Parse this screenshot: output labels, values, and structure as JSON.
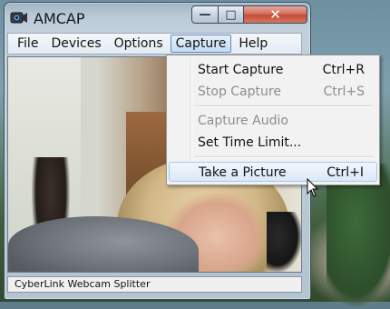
{
  "window": {
    "title": "AMCAP",
    "controls": {
      "minimize": "—",
      "maximize": "□",
      "close": "✕"
    }
  },
  "menubar": {
    "items": [
      {
        "label": "File"
      },
      {
        "label": "Devices"
      },
      {
        "label": "Options"
      },
      {
        "label": "Capture"
      },
      {
        "label": "Help"
      }
    ],
    "active": "Capture"
  },
  "capture_menu": {
    "items": [
      {
        "label": "Start Capture",
        "shortcut": "Ctrl+R",
        "enabled": true
      },
      {
        "label": "Stop Capture",
        "shortcut": "Ctrl+S",
        "enabled": false
      },
      {
        "label": "Capture Audio",
        "shortcut": "",
        "enabled": false
      },
      {
        "label": "Set Time Limit...",
        "shortcut": "",
        "enabled": true
      },
      {
        "label": "Take a Picture",
        "shortcut": "Ctrl+I",
        "enabled": true,
        "highlighted": true
      }
    ]
  },
  "statusbar": {
    "text": "CyberLink Webcam Splitter"
  },
  "icons": {
    "app": "webcam-icon",
    "cursor": "arrow-cursor-icon"
  },
  "colors": {
    "close_button": "#c24a36",
    "menu_highlight_border": "#5e8ab8",
    "disabled_text": "#8d8d8d"
  }
}
